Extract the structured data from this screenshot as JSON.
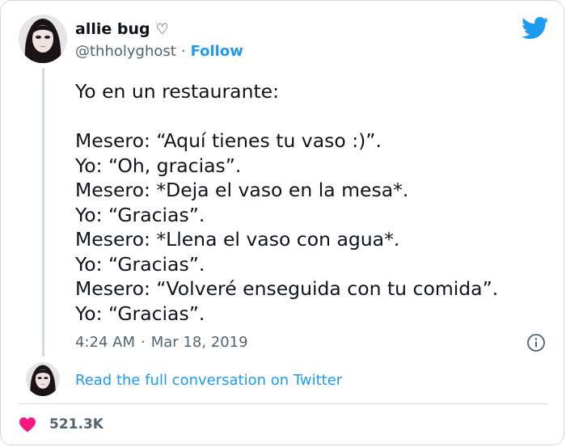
{
  "author": {
    "name": "allie bug",
    "name_emoji": "♡",
    "handle": "@thholyghost",
    "separator": "·",
    "follow_label": "Follow"
  },
  "tweet": {
    "lines": [
      "Yo en un restaurante:",
      "",
      "Mesero: “Aquí tienes tu vaso :)”.",
      "Yo: “Oh, gracias”.",
      "Mesero: *Deja el vaso en la mesa*.",
      "Yo: “Gracias”.",
      "Mesero: *Llena el vaso con agua*.",
      "Yo: “Gracias”.",
      "Mesero: “Volveré enseguida con tu comida”.",
      "Yo: “Gracias”."
    ],
    "time": "4:24 AM",
    "date": "Mar 18, 2019"
  },
  "conversation": {
    "link_label": "Read the full conversation on Twitter"
  },
  "engagement": {
    "likes": "521.3K"
  },
  "colors": {
    "accent": "#1d9bf0",
    "like": "#f91880",
    "secondary_text": "#536471",
    "border": "#cfd9de"
  },
  "icons": {
    "brand": "twitter-bird-icon",
    "info": "info-icon",
    "like": "heart-icon"
  }
}
